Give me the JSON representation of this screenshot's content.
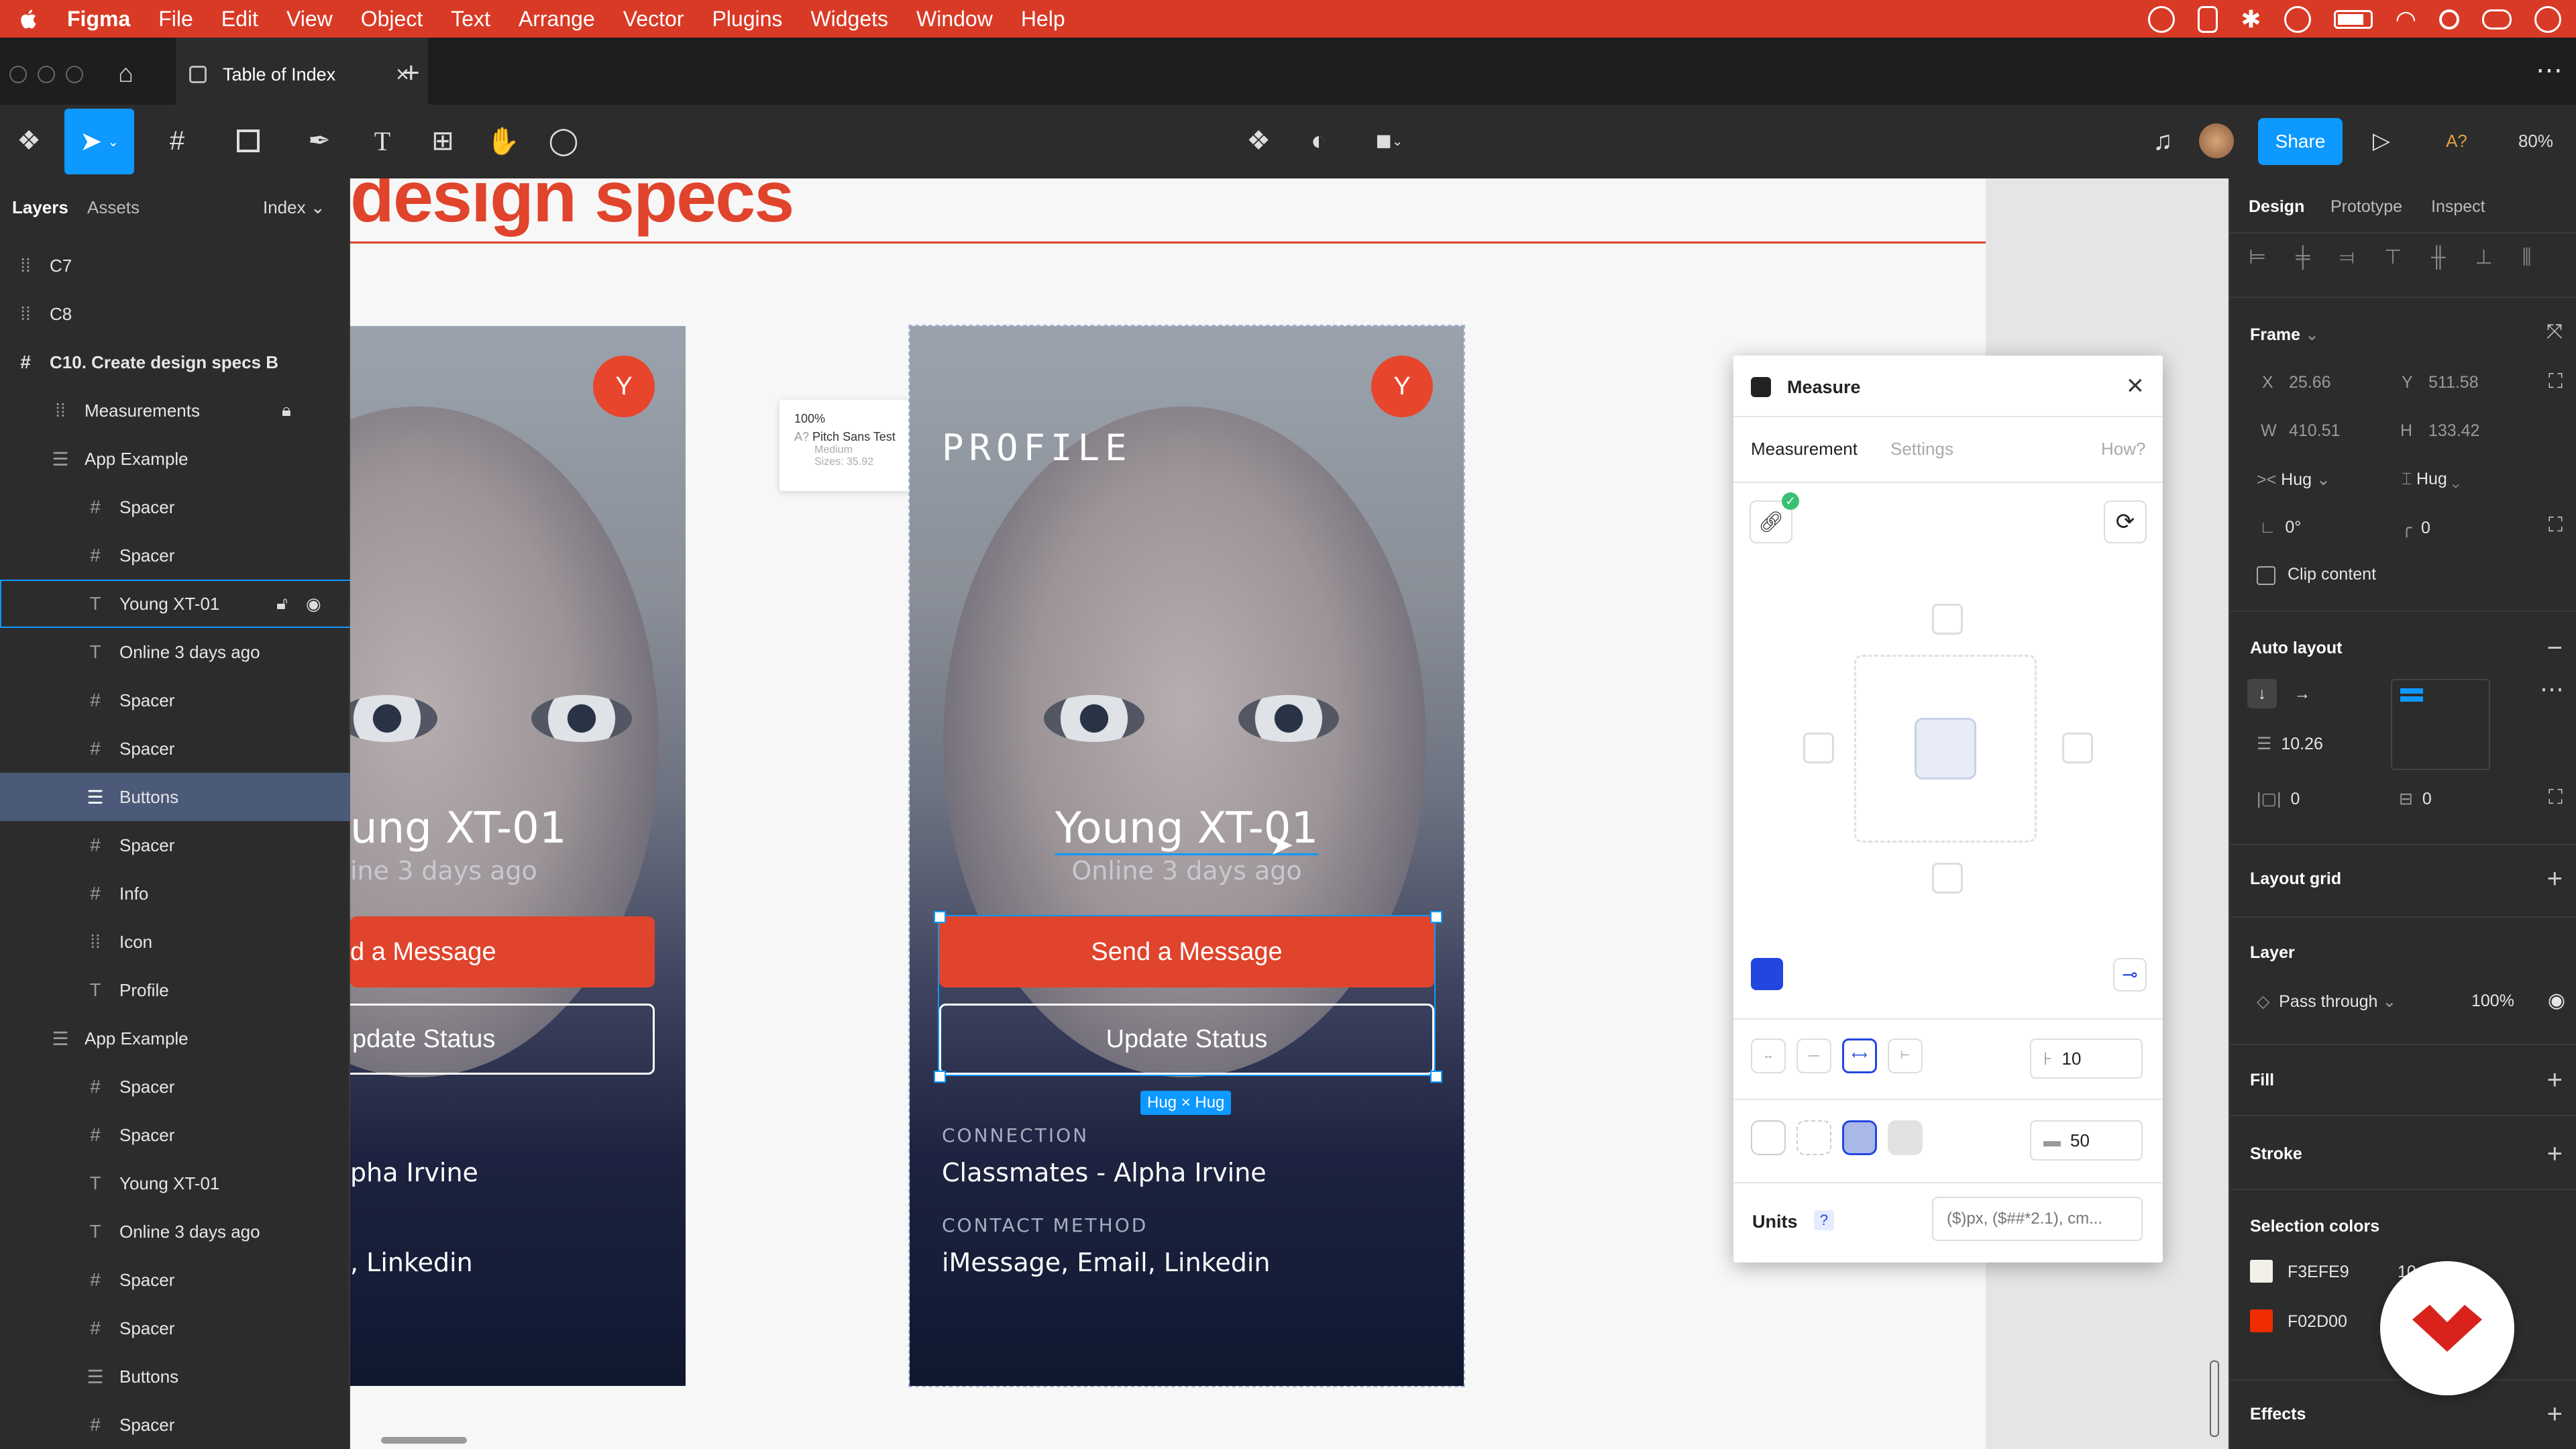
{
  "menubar": {
    "items": [
      "Figma",
      "File",
      "Edit",
      "View",
      "Object",
      "Text",
      "Arrange",
      "Vector",
      "Plugins",
      "Widgets",
      "Window",
      "Help"
    ]
  },
  "tabbar": {
    "tab_title": "Table of Index"
  },
  "toolbar": {
    "share_label": "Share",
    "zoom": "80%",
    "a_label": "A?"
  },
  "left": {
    "tabs": [
      "Layers",
      "Assets"
    ],
    "page": "Index",
    "layers": [
      "C7",
      "C8",
      "C10. Create design specs B",
      "Measurements",
      "App Example",
      "Spacer",
      "Spacer",
      "Young XT-01",
      "Online 3 days ago",
      "Spacer",
      "Spacer",
      "Buttons",
      "Spacer",
      "Info",
      "Icon",
      "Profile",
      "App Example",
      "Spacer",
      "Spacer",
      "Young XT-01",
      "Online 3 days ago",
      "Spacer",
      "Spacer",
      "Buttons",
      "Spacer"
    ]
  },
  "canvas": {
    "heading": "design specs",
    "left_phone": {
      "name": "ung XT-01",
      "status": "ine 3 days ago",
      "btn1": "d a Message",
      "btn2": "pdate Status",
      "info1": "pha Irvine",
      "info2": ", Linkedin",
      "avatar": "Y"
    },
    "right_phone": {
      "profile": "PROFILE",
      "name": "Young XT-01",
      "status": "Online 3 days ago",
      "btn1": "Send a Message",
      "btn2": "Update Status",
      "label1": "CONNECTION",
      "info1": "Classmates - Alpha Irvine",
      "label2": "CONTACT METHOD",
      "info2": "iMessage, Email, Linkedin",
      "avatar": "Y"
    },
    "hug_badge": "Hug × Hug",
    "spec_tag": {
      "percent": "100%",
      "a_label": "A?",
      "font": "Pitch Sans Test",
      "weight": "Medium",
      "sizes": "Sizes: 35.92"
    }
  },
  "measure": {
    "title": "Measure",
    "tabs": [
      "Measurement",
      "Settings"
    ],
    "how": "How?",
    "value1": "10",
    "value2": "50",
    "units_label": "Units",
    "units_help": "?",
    "units_placeholder": "($)px, ($##*2.1), cm...",
    "swatch": "#2346e0"
  },
  "right": {
    "tabs": [
      "Design",
      "Prototype",
      "Inspect"
    ],
    "frame_label": "Frame",
    "x_label": "X",
    "x": "25.66",
    "y_label": "Y",
    "y": "511.58",
    "w_label": "W",
    "w": "410.51",
    "h_label": "H",
    "h": "133.42",
    "hug_w": "Hug",
    "hug_h": "Hug",
    "rotation": "0°",
    "radius": "0",
    "clip": "Clip content",
    "auto_layout": "Auto layout",
    "spacing": "10.26",
    "pad_h": "0",
    "pad_v": "0",
    "layout_grid": "Layout grid",
    "layer": "Layer",
    "blend": "Pass through",
    "opacity": "100%",
    "fill": "Fill",
    "stroke": "Stroke",
    "selection_colors": "Selection colors",
    "color1": "F3EFE9",
    "color1_pct": "10",
    "color2": "F02D00",
    "effects": "Effects"
  },
  "colors": {
    "menubar": "#d93a26",
    "share": "#0d99ff",
    "accent": "#e0442c",
    "selection": "#0d99ff"
  }
}
